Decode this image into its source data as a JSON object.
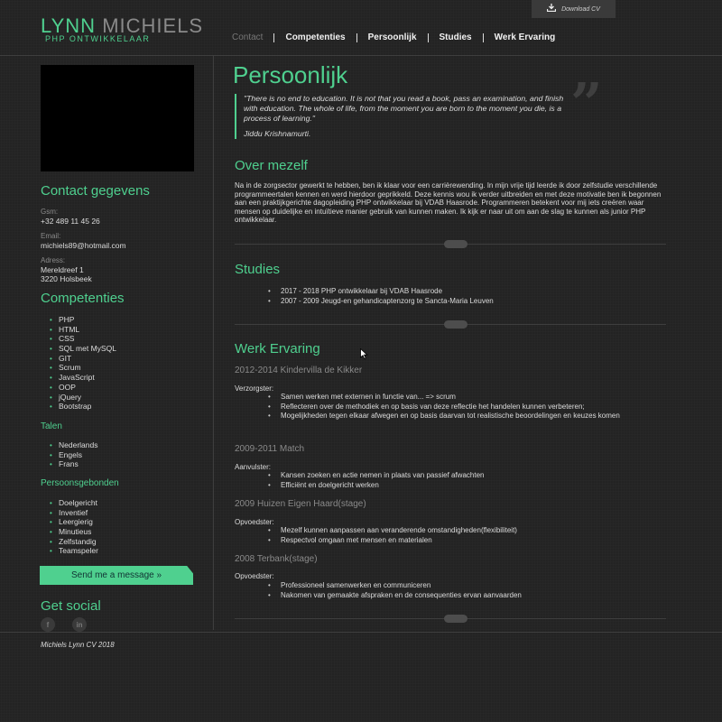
{
  "header": {
    "first_name": "LYNN",
    "last_name": "MICHIELS",
    "subtitle": "PHP ONTWIKKELAAR",
    "download_label": "Download CV",
    "nav": [
      "Contact",
      "Competenties",
      "Persoonlijk",
      "Studies",
      "Werk Ervaring"
    ]
  },
  "sidebar": {
    "contact_heading": "Contact gegevens",
    "gsm_label": "Gsm:",
    "gsm_value": "+32 489 11 45 26",
    "email_label": "Email:",
    "email_value": "michiels89@hotmail.com",
    "address_label": "Adress:",
    "address_line1": "Mereldreef 1",
    "address_line2": "3220 Holsbeek",
    "competenties_heading": "Competenties",
    "competenties": [
      "PHP",
      "HTML",
      "CSS",
      "SQL met MySQL",
      "GIT",
      "Scrum",
      "JavaScript",
      "OOP",
      "jQuery",
      "Bootstrap"
    ],
    "talen_heading": "Talen",
    "talen": [
      "Nederlands",
      "Engels",
      "Frans"
    ],
    "persoonsgebonden_heading": "Persoonsgebonden",
    "persoonsgebonden": [
      "Doelgericht",
      "Inventief",
      "Leergierig",
      "Minutieus",
      "Zelfstandig",
      "Teamspeler"
    ],
    "send_button": "Send me a message »",
    "social_heading": "Get social",
    "social": [
      "f",
      "in"
    ]
  },
  "main": {
    "title": "Persoonlijk",
    "quote": "\"There is no end to education. It is not that you read a book, pass an examination, and finish with education. The whole of life, from the moment you are born to the moment you die, is a process of learning.\"",
    "quote_author": "Jiddu Krishnamurti.",
    "quote_mark": "”",
    "about_heading": "Over mezelf",
    "about_text": "Na in de zorgsector gewerkt te hebben, ben ik klaar voor een carrièrewending. In mijn vrije tijd leerde ik door zelfstudie verschillende programmeertalen kennen en werd hierdoor geprikkeld. Deze kennis wou ik verder uitbreiden en met deze motivatie ben ik begonnen aan een praktijkgerichte dagopleiding PHP ontwikkelaar bij VDAB Haasrode. Programmeren betekent voor mij iets creëren waar mensen op duidelijke en intuïtieve manier gebruik van kunnen maken. Ik kijk er naar uit om aan de slag te kunnen als junior PHP ontwikkelaar.",
    "studies_heading": "Studies",
    "studies": [
      "2017 - 2018 PHP ontwikkelaar bij VDAB Haasrode",
      "2007 - 2009 Jeugd-en gehandicaptenzorg te Sancta-Maria Leuven"
    ],
    "werk_heading": "Werk Ervaring",
    "jobs": [
      {
        "title": "2012-2014 Kindervilla de Kikker",
        "role": "Verzorgster:",
        "items": [
          "Samen werken met externen in functie van... => scrum",
          "Reflecteren over de methodiek en op basis van deze reflectie het handelen kunnen verbeteren;",
          "Mogelijkheden tegen elkaar afwegen en op basis daarvan tot realistische beoordelingen en keuzes komen"
        ]
      },
      {
        "title": "2009-2011 Match",
        "role": "Aanvulster:",
        "items": [
          "Kansen zoeken en actie nemen in plaats van passief afwachten",
          "Efficiënt en doelgericht werken"
        ]
      },
      {
        "title": "2009 Huizen Eigen Haard(stage)",
        "role": "Opvoedster:",
        "items": [
          "Mezelf kunnen aanpassen aan veranderende omstandigheden(flexibiliteit)",
          "Respectvol omgaan met mensen en materialen"
        ]
      },
      {
        "title": "2008 Terbank(stage)",
        "role": "Opvoedster:",
        "items": [
          "Professioneel samenwerken en communiceren",
          "Nakomen van gemaakte afspraken en de consequenties ervan aanvaarden"
        ]
      }
    ]
  },
  "footer": {
    "text": "Michiels Lynn CV 2018"
  },
  "colors": {
    "accent": "#4fd08f",
    "background": "#232323",
    "muted": "#8a8a8a"
  }
}
